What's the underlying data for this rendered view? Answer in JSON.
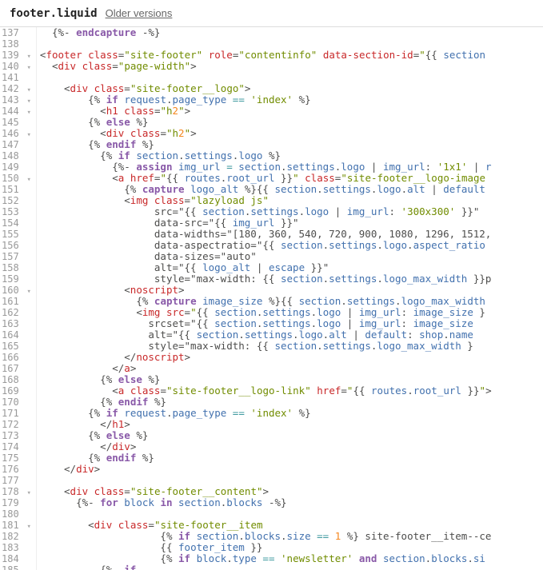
{
  "header": {
    "filename": "footer.liquid",
    "older_versions": "Older versions"
  },
  "lines_start": 137,
  "fold_lines": [
    139,
    140,
    142,
    143,
    144,
    146,
    150,
    160,
    178,
    181
  ],
  "code_lines": [
    "  {%- endcapture -%}",
    "",
    "<footer class=\"site-footer\" role=\"contentinfo\" data-section-id=\"{{ section",
    "  <div class=\"page-width\">",
    "",
    "    <div class=\"site-footer__logo\">",
    "        {% if request.page_type == 'index' %}",
    "          <h1 class=\"h2\">",
    "        {% else %}",
    "          <div class=\"h2\">",
    "        {% endif %}",
    "          {% if section.settings.logo %}",
    "            {%- assign img_url = section.settings.logo | img_url: '1x1' | r",
    "            <a href=\"{{ routes.root_url }}\" class=\"site-footer__logo-image",
    "              {% capture logo_alt %}{{ section.settings.logo.alt | default",
    "              <img class=\"lazyload js\"",
    "                   src=\"{{ section.settings.logo | img_url: '300x300' }}\"",
    "                   data-src=\"{{ img_url }}\"",
    "                   data-widths=\"[180, 360, 540, 720, 900, 1080, 1296, 1512,",
    "                   data-aspectratio=\"{{ section.settings.logo.aspect_ratio",
    "                   data-sizes=\"auto\"",
    "                   alt=\"{{ logo_alt | escape }}\"",
    "                   style=\"max-width: {{ section.settings.logo_max_width }}p",
    "              <noscript>",
    "                {% capture image_size %}{{ section.settings.logo_max_width",
    "                <img src=\"{{ section.settings.logo | img_url: image_size }",
    "                  srcset=\"{{ section.settings.logo | img_url: image_size",
    "                  alt=\"{{ section.settings.logo.alt | default: shop.name",
    "                  style=\"max-width: {{ section.settings.logo_max_width }",
    "              </noscript>",
    "            </a>",
    "          {% else %}",
    "            <a class=\"site-footer__logo-link\" href=\"{{ routes.root_url }}\">",
    "          {% endif %}",
    "        {% if request.page_type == 'index' %}",
    "          </h1>",
    "        {% else %}",
    "          </div>",
    "        {% endif %}",
    "    </div>",
    "",
    "    <div class=\"site-footer__content\">",
    "      {%- for block in section.blocks -%}",
    "",
    "        <div class=\"site-footer__item",
    "                    {% if section.blocks.size == 1 %} site-footer__item--ce",
    "                    {{ footer_item }}",
    "                    {% if block.type == 'newsletter' and section.blocks.si",
    "          {%- if"
  ]
}
